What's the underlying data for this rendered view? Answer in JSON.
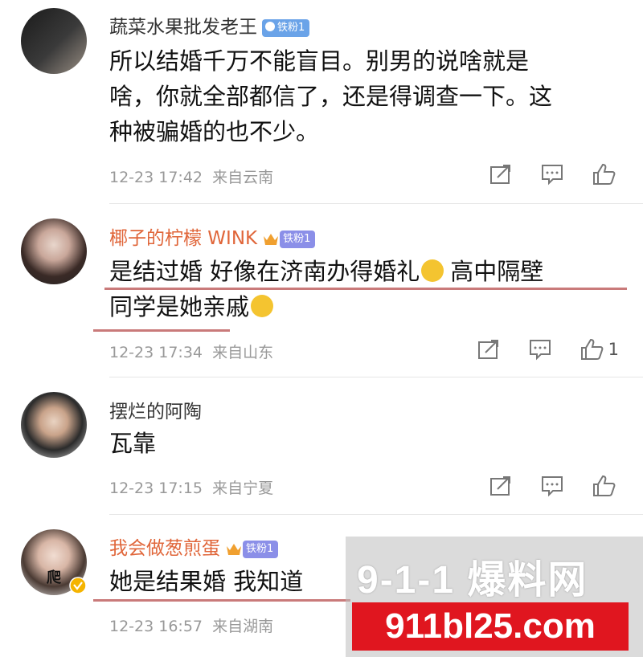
{
  "comments": [
    {
      "username": "蔬菜水果批发老王",
      "badge": "铁粉1",
      "lines": [
        "所以结婚千万不能盲目。别男的说啥就是",
        "啥，你就全部都信了，还是得调查一下。这",
        "种被骗婚的也不少。"
      ],
      "time": "12-23 17:42",
      "location": "来自云南",
      "likes": ""
    },
    {
      "username": "椰子的柠檬 WINK",
      "badge": "铁粉1",
      "line1a": "是结过婚 好像在济南办得婚礼",
      "line1b": "高中隔壁",
      "line2": "同学是她亲戚",
      "time": "12-23 17:34",
      "location": "来自山东",
      "likes": "1"
    },
    {
      "username": "摆烂的阿陶",
      "lines": [
        "瓦靠"
      ],
      "time": "12-23 17:15",
      "location": "来自宁夏",
      "likes": ""
    },
    {
      "username": "我会做葱煎蛋",
      "badge": "铁粉1",
      "avatar_text": "爬",
      "lines": [
        "她是结果婚 我知道"
      ],
      "time": "12-23 16:57",
      "location": "来自湖南",
      "likes": ""
    }
  ],
  "watermark": {
    "logo": "9-1-1 爆料网",
    "url": "911bl25.com"
  },
  "colors": {
    "vip_name": "#e0663a",
    "badge_blue": "#6aa3e8",
    "meta": "#999999",
    "watermark_red": "#e0161f"
  }
}
